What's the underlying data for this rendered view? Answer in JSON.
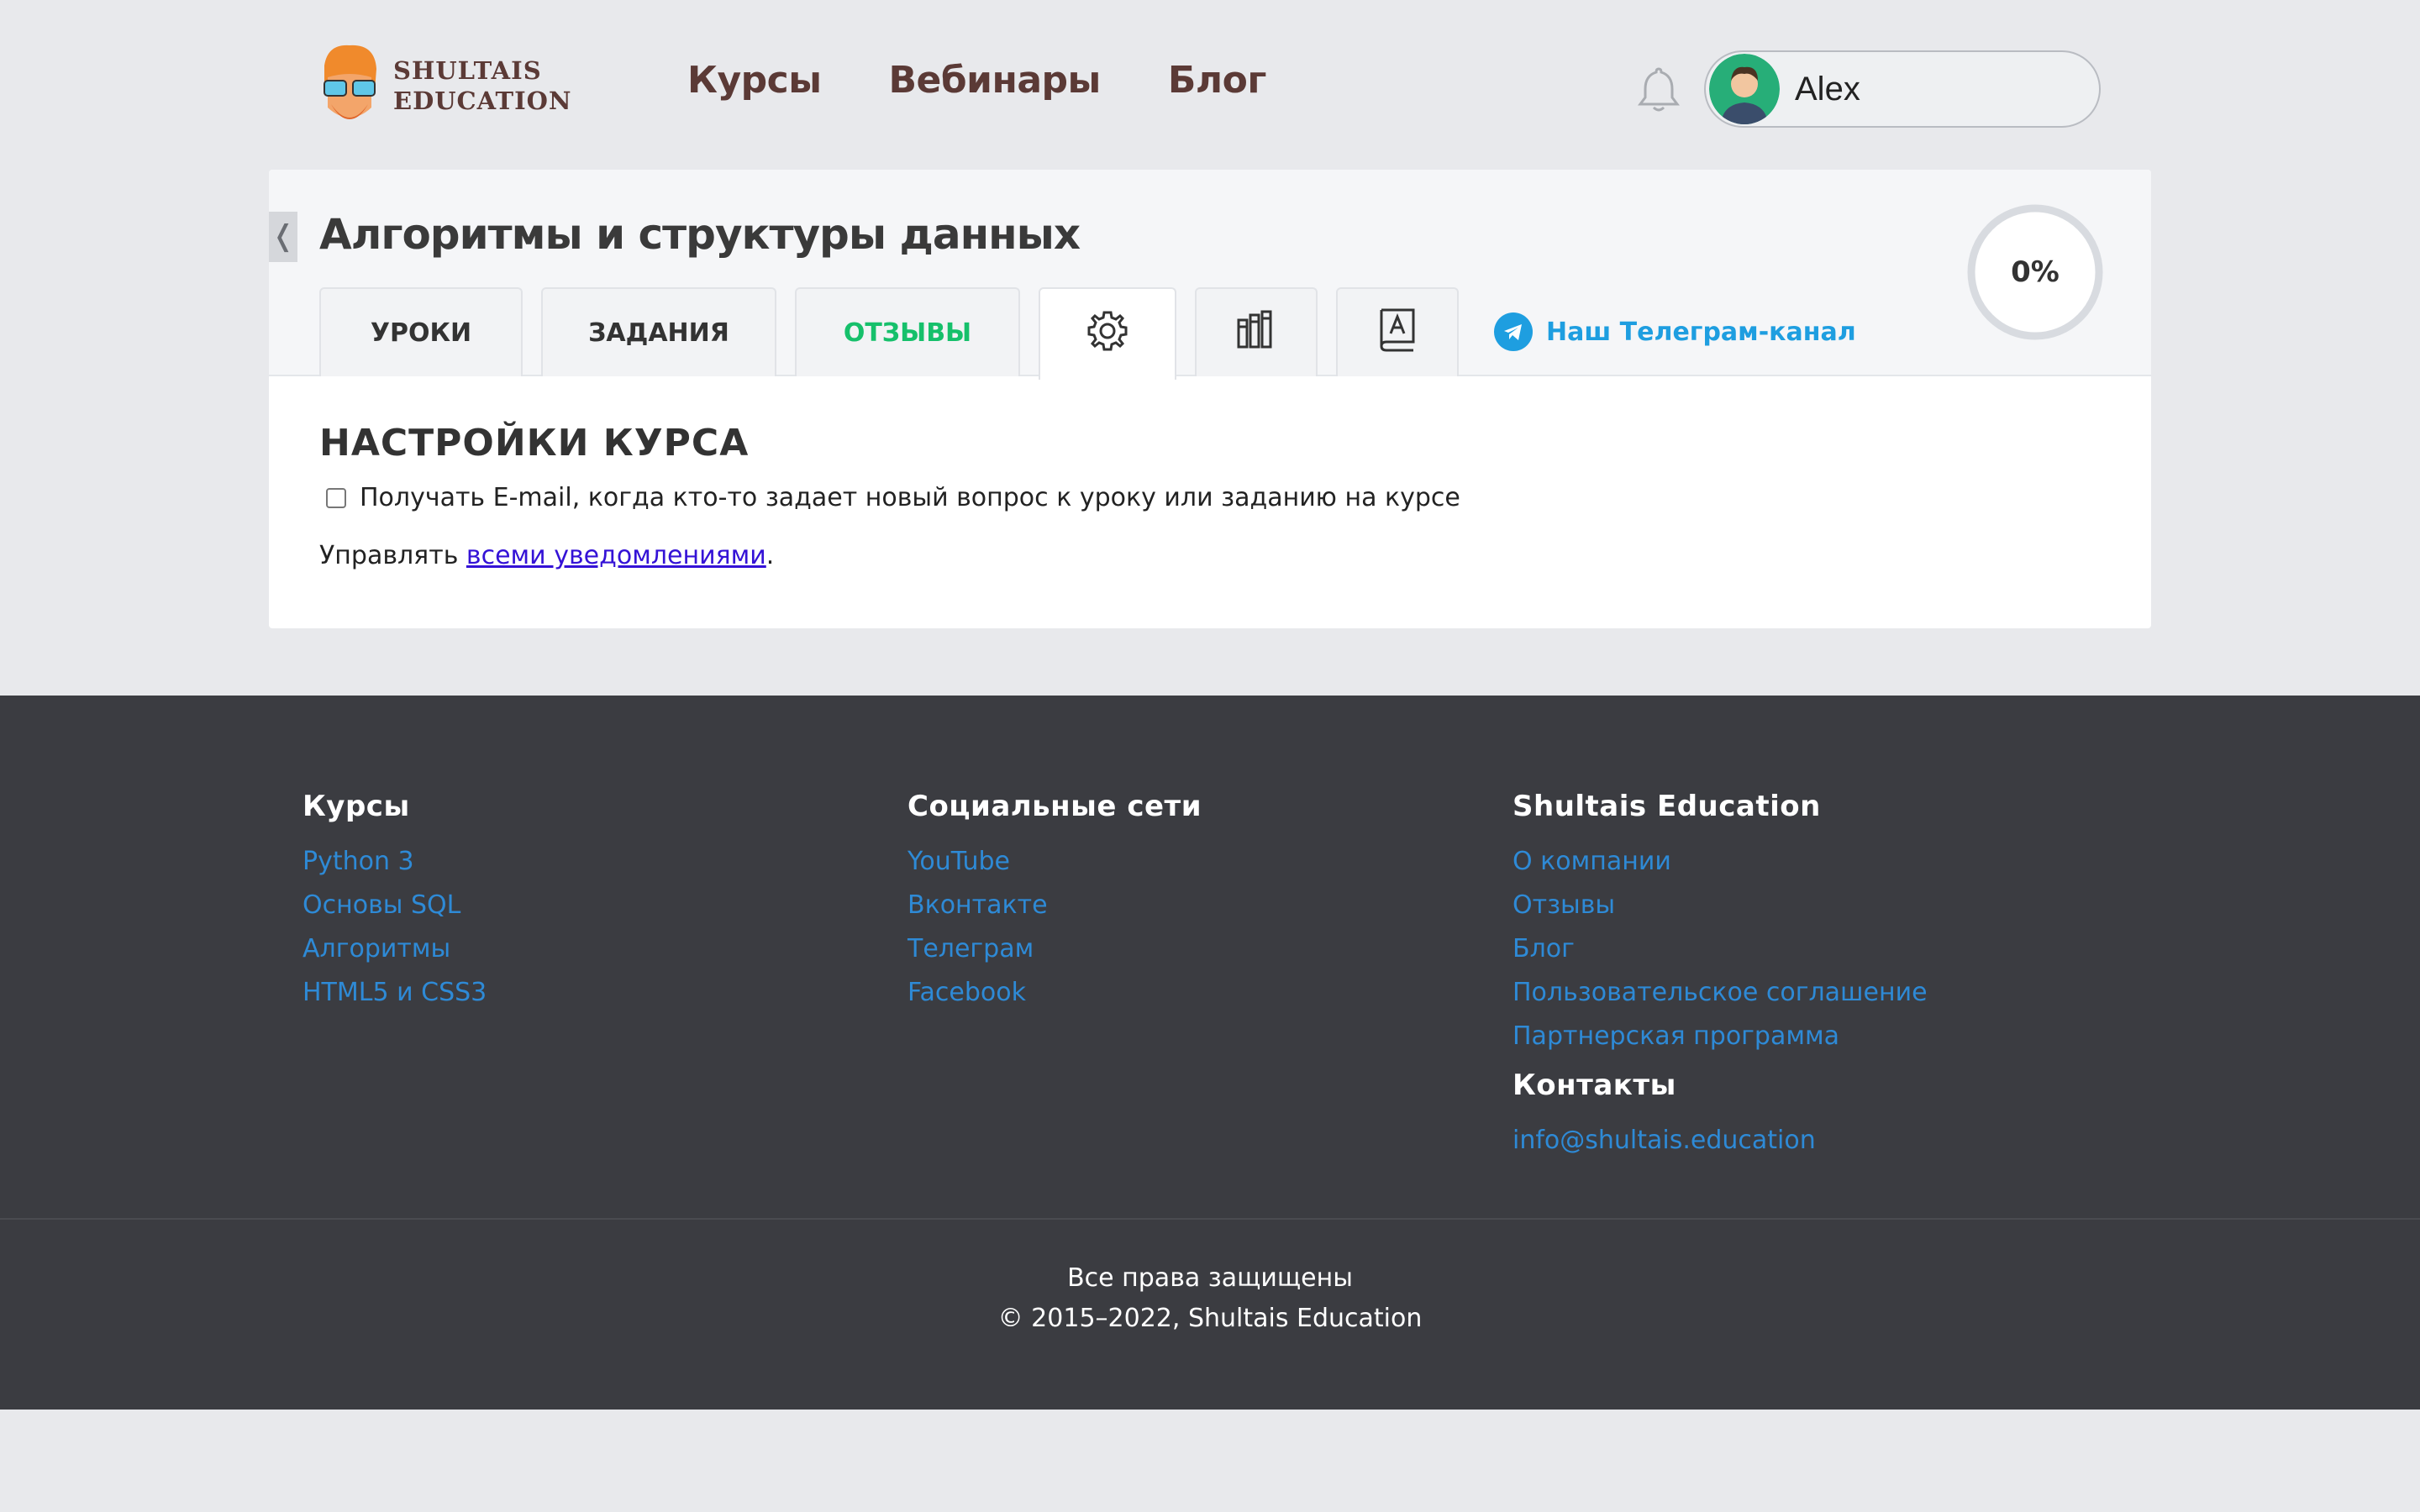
{
  "brand": {
    "line1": "SHULTAIS",
    "line2": "EDUCATION"
  },
  "nav": {
    "courses": "Курсы",
    "webinars": "Вебинары",
    "blog": "Блог"
  },
  "user": {
    "name": "Alex"
  },
  "course": {
    "title": "Алгоритмы и структуры данных",
    "progress": "0%",
    "back_icon": "❬"
  },
  "tabs": {
    "lessons": "УРОКИ",
    "tasks": "ЗАДАНИЯ",
    "reviews": "ОТЗЫВЫ",
    "telegram": "Наш Телеграм-канал"
  },
  "settings": {
    "title": "НАСТРОЙКИ КУРСА",
    "email_option": "Получать E-mail, когда кто-то задает новый вопрос к уроку или заданию на курсе",
    "manage_prefix": "Управлять ",
    "manage_link": "всеми уведомлениями",
    "manage_suffix": "."
  },
  "footer": {
    "courses": {
      "heading": "Курсы",
      "links": [
        "Python 3",
        "Основы SQL",
        "Алгоритмы",
        "HTML5 и CSS3"
      ]
    },
    "social": {
      "heading": "Социальные сети",
      "links": [
        "YouTube",
        "Вконтакте",
        "Телеграм",
        "Facebook"
      ]
    },
    "company": {
      "heading": "Shultais Education",
      "links": [
        "О компании",
        "Отзывы",
        "Блог",
        "Пользовательское соглашение",
        "Партнерская программа"
      ],
      "contacts_heading": "Контакты",
      "email": "info@shultais.education"
    },
    "rights": "Все права защищены",
    "copyright": "© 2015–2022, Shultais Education"
  },
  "colors": {
    "brand": "#5b3a36",
    "link": "#2e8ad6",
    "green": "#16c06b",
    "telegram": "#1e9ee0"
  }
}
